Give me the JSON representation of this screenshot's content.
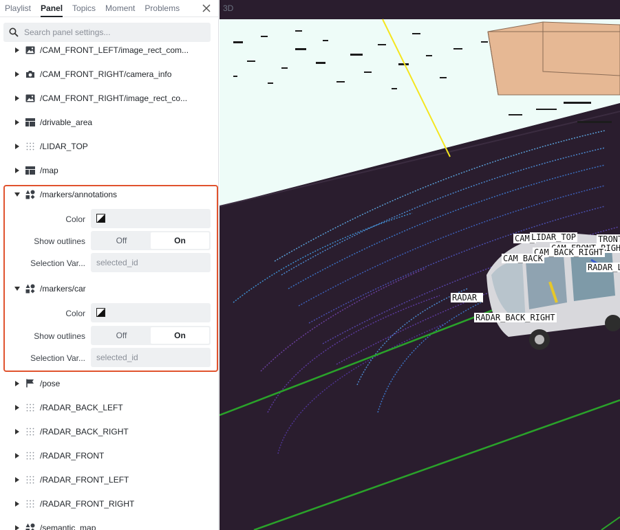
{
  "tabs": [
    {
      "label": "Playlist",
      "active": false
    },
    {
      "label": "Panel",
      "active": true
    },
    {
      "label": "Topics",
      "active": false
    },
    {
      "label": "Moment",
      "active": false
    },
    {
      "label": "Problems",
      "active": false
    }
  ],
  "search": {
    "placeholder": "Search panel settings..."
  },
  "topics": [
    {
      "label": "/CAM_FRONT_LEFT/image_rect_com...",
      "icon": "image-icon"
    },
    {
      "label": "/CAM_FRONT_RIGHT/camera_info",
      "icon": "camera-icon"
    },
    {
      "label": "/CAM_FRONT_RIGHT/image_rect_co...",
      "icon": "image-icon"
    },
    {
      "label": "/drivable_area",
      "icon": "grid-map-icon"
    },
    {
      "label": "/LIDAR_TOP",
      "icon": "pointcloud-icon"
    },
    {
      "label": "/map",
      "icon": "grid-map-icon"
    },
    {
      "label": "/markers/annotations",
      "icon": "shapes-icon",
      "expanded": true
    },
    {
      "label": "/markers/car",
      "icon": "shapes-icon",
      "expanded": true
    },
    {
      "label": "/pose",
      "icon": "flag-icon"
    },
    {
      "label": "/RADAR_BACK_LEFT",
      "icon": "pointcloud-icon"
    },
    {
      "label": "/RADAR_BACK_RIGHT",
      "icon": "pointcloud-icon"
    },
    {
      "label": "/RADAR_FRONT",
      "icon": "pointcloud-icon"
    },
    {
      "label": "/RADAR_FRONT_LEFT",
      "icon": "pointcloud-icon"
    },
    {
      "label": "/RADAR_FRONT_RIGHT",
      "icon": "pointcloud-icon"
    },
    {
      "label": "/semantic_map",
      "icon": "shapes-icon"
    }
  ],
  "settings": {
    "color_label": "Color",
    "outlines_label": "Show outlines",
    "off_label": "Off",
    "on_label": "On",
    "selection_label": "Selection Var...",
    "selection_placeholder": "selected_id"
  },
  "viewport": {
    "label": "3D",
    "frame_labels": [
      "LIDAR_TOP",
      "CAM_FRONT_RIGHT",
      "CAM_",
      "TRONT",
      "CAM_BACK_RIGHT",
      "CAM_BACK",
      "RADAR_",
      "RADAR_L",
      "RADAR_BACK_RIGHT"
    ]
  },
  "colors": {
    "highlight_border": "#e0522d",
    "ground": "#2a1d2e",
    "sky": "#eefcf8",
    "box": "#e6b894",
    "lane_line": "#2aa22a",
    "axis_line": "#f5e51f"
  }
}
